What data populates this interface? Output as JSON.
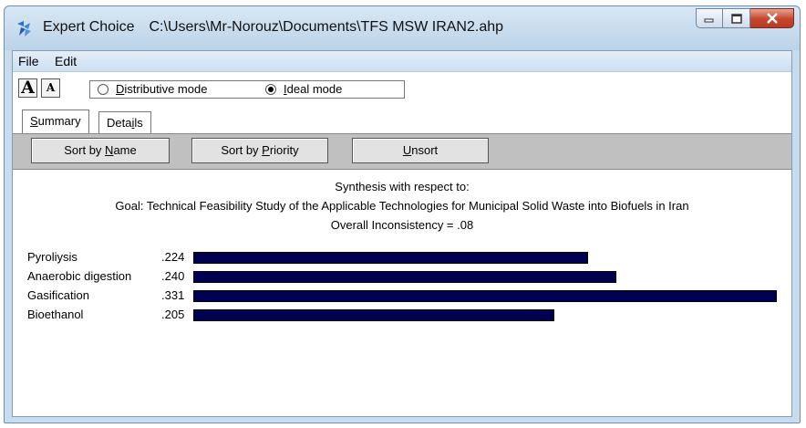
{
  "window": {
    "app_name": "Expert Choice",
    "file_path": "C:\\Users\\Mr-Norouz\\Documents\\TFS MSW IRAN2.ahp"
  },
  "menu": [
    "File",
    "Edit"
  ],
  "font_buttons": {
    "increase": "A",
    "decrease": "A"
  },
  "modes": {
    "distributive": {
      "pre": "",
      "accel": "D",
      "post": "istributive mode",
      "selected": false
    },
    "ideal": {
      "pre": "",
      "accel": "I",
      "post": "deal mode",
      "selected": true
    }
  },
  "tabs": [
    {
      "pre": "",
      "accel": "S",
      "post": "ummary",
      "active": true
    },
    {
      "pre": "Deta",
      "accel": "i",
      "post": "ls",
      "active": false
    }
  ],
  "sort_buttons": [
    {
      "pre": "Sort by ",
      "accel": "N",
      "post": "ame"
    },
    {
      "pre": "Sort by ",
      "accel": "P",
      "post": "riority"
    },
    {
      "pre": "",
      "accel": "U",
      "post": "nsort"
    }
  ],
  "synthesis": {
    "heading": "Synthesis with respect to:",
    "goal": "Goal: Technical Feasibility Study of the Applicable Technologies for Municipal Solid Waste into Biofuels in Iran",
    "inconsistency": "Overall Inconsistency = .08"
  },
  "chart_data": {
    "type": "bar",
    "orientation": "horizontal",
    "categories": [
      "Pyroliysis",
      "Anaerobic digestion",
      "Gasification",
      "Bioethanol"
    ],
    "values": [
      0.224,
      0.24,
      0.331,
      0.205
    ],
    "value_labels": [
      ".224",
      ".240",
      ".331",
      ".205"
    ],
    "bar_color": "#000052"
  }
}
